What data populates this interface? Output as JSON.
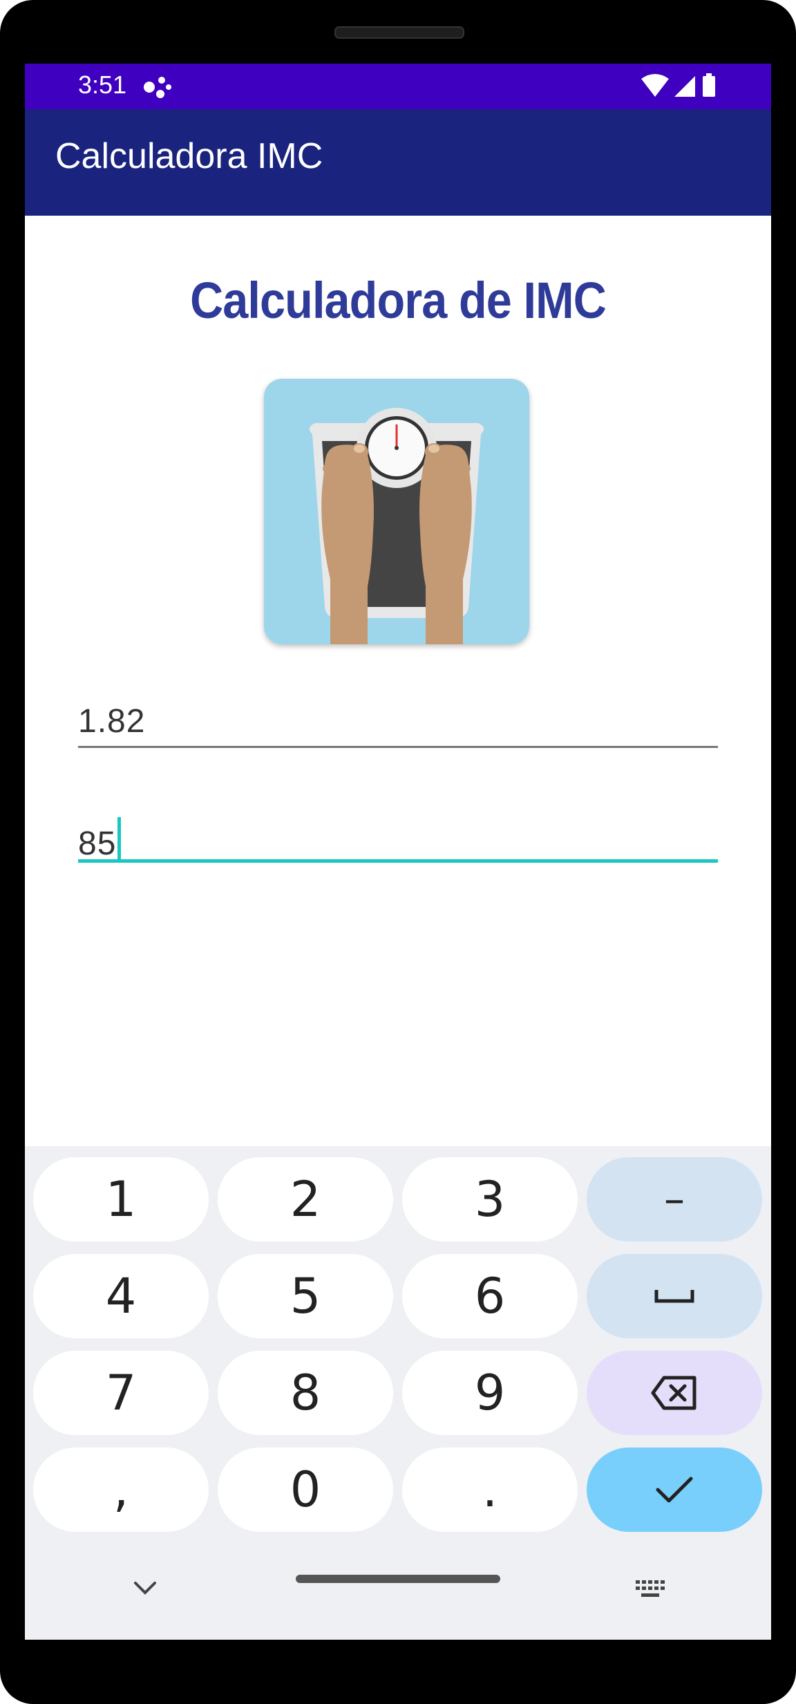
{
  "status_bar": {
    "time": "3:51"
  },
  "app_bar": {
    "title": "Calculadora IMC"
  },
  "main": {
    "heading": "Calculadora de IMC",
    "height_value": "1.82",
    "weight_value": "85"
  },
  "keyboard": {
    "rows": [
      [
        "1",
        "2",
        "3",
        "–"
      ],
      [
        "4",
        "5",
        "6",
        "space"
      ],
      [
        "7",
        "8",
        "9",
        "backspace"
      ],
      [
        ",",
        "0",
        ".",
        "done"
      ]
    ]
  },
  "colors": {
    "status_bar": "#3f00bf",
    "app_bar": "#1a237e",
    "heading": "#2f3b98",
    "accent": "#19c7c0",
    "keyboard_bg": "#eff0f3",
    "enter_key": "#78cffb"
  }
}
